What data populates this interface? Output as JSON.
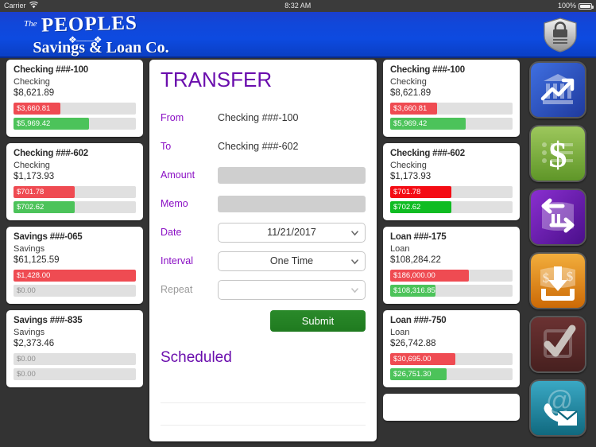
{
  "status_bar": {
    "carrier": "Carrier",
    "wifi_icon": "wifi-icon",
    "time": "8:32 AM",
    "battery_percent": "100%",
    "battery_icon": "battery-icon"
  },
  "header": {
    "logo_the": "The",
    "logo_main": "PEOPLES",
    "logo_sub": "Savings & Loan Co.",
    "shield_icon": "shield-lock-icon",
    "brand_blue": "#0d4ae0"
  },
  "left_accounts": [
    {
      "name": "Checking ###-100",
      "type": "Checking",
      "balance": "$8,621.89",
      "bars": [
        {
          "label": "$3,660.81",
          "color": "#ef4b52",
          "width_pct": 38,
          "label_color": "light"
        },
        {
          "label": "$5,969.42",
          "color": "#4cc35a",
          "width_pct": 62,
          "label_color": "light"
        }
      ]
    },
    {
      "name": "Checking ###-602",
      "type": "Checking",
      "balance": "$1,173.93",
      "bars": [
        {
          "label": "$701.78",
          "color": "#ef4b52",
          "width_pct": 50,
          "label_color": "light"
        },
        {
          "label": "$702.62",
          "color": "#4cc35a",
          "width_pct": 50,
          "label_color": "light"
        }
      ]
    },
    {
      "name": "Savings ###-065",
      "type": "Savings",
      "balance": "$61,125.59",
      "bars": [
        {
          "label": "$1,428.00",
          "color": "#ef4b52",
          "width_pct": 100,
          "label_color": "light"
        },
        {
          "label": "$0.00",
          "color": "#e0e0e0",
          "width_pct": 0,
          "label_color": "dark"
        }
      ]
    },
    {
      "name": "Savings ###-835",
      "type": "Savings",
      "balance": "$2,373.46",
      "bars": [
        {
          "label": "$0.00",
          "color": "#e0e0e0",
          "width_pct": 0,
          "label_color": "dark"
        },
        {
          "label": "$0.00",
          "color": "#e0e0e0",
          "width_pct": 0,
          "label_color": "dark"
        }
      ]
    }
  ],
  "right_accounts": [
    {
      "name": "Checking ###-100",
      "type": "Checking",
      "balance": "$8,621.89",
      "bars": [
        {
          "label": "$3,660.81",
          "color": "#ef4b52",
          "width_pct": 38,
          "label_color": "light"
        },
        {
          "label": "$5,969.42",
          "color": "#4cc35a",
          "width_pct": 62,
          "label_color": "light"
        }
      ]
    },
    {
      "name": "Checking ###-602",
      "type": "Checking",
      "balance": "$1,173.93",
      "bars": [
        {
          "label": "$701.78",
          "color": "#f40c14",
          "width_pct": 50,
          "label_color": "light"
        },
        {
          "label": "$702.62",
          "color": "#0fbc22",
          "width_pct": 50,
          "label_color": "light"
        }
      ]
    },
    {
      "name": "Loan ###-175",
      "type": "Loan",
      "balance": "$108,284.22",
      "bars": [
        {
          "label": "$186,000.00",
          "color": "#ef4b52",
          "width_pct": 64,
          "label_color": "light"
        },
        {
          "label": "$108,316.85",
          "color": "#4cc35a",
          "width_pct": 37,
          "label_color": "light"
        }
      ]
    },
    {
      "name": "Loan ###-750",
      "type": "Loan",
      "balance": "$26,742.88",
      "bars": [
        {
          "label": "$30,695.00",
          "color": "#ef4b52",
          "width_pct": 53,
          "label_color": "light"
        },
        {
          "label": "$26,751.30",
          "color": "#4cc35a",
          "width_pct": 46,
          "label_color": "light"
        }
      ]
    }
  ],
  "transfer": {
    "title": "TRANSFER",
    "from_label": "From",
    "from_value": "Checking ###-100",
    "to_label": "To",
    "to_value": "Checking ###-602",
    "amount_label": "Amount",
    "amount_value": "",
    "amount_placeholder": "",
    "memo_label": "Memo",
    "memo_value": "",
    "memo_placeholder": "",
    "date_label": "Date",
    "date_value": "11/21/2017",
    "interval_label": "Interval",
    "interval_value": "One Time",
    "repeat_label": "Repeat",
    "repeat_value": "",
    "submit_label": "Submit",
    "scheduled_title": "Scheduled",
    "accent_purple": "#6a0dad",
    "submit_green": "#1f7a1f"
  },
  "icon_rail": [
    {
      "name": "accounts-overview-icon",
      "tooltip": "Accounts",
      "color": "#2a56c8"
    },
    {
      "name": "payments-dollar-icon",
      "tooltip": "Payments",
      "color": "#7bb33a"
    },
    {
      "name": "transfer-arrows-icon",
      "tooltip": "Transfer",
      "color": "#6b21a8"
    },
    {
      "name": "deposit-icon",
      "tooltip": "Deposit",
      "color": "#e08a14"
    },
    {
      "name": "approvals-check-icon",
      "tooltip": "Approvals",
      "color": "#5a2c2c"
    },
    {
      "name": "contact-icon",
      "tooltip": "Contact",
      "color": "#1f8aa8"
    }
  ]
}
